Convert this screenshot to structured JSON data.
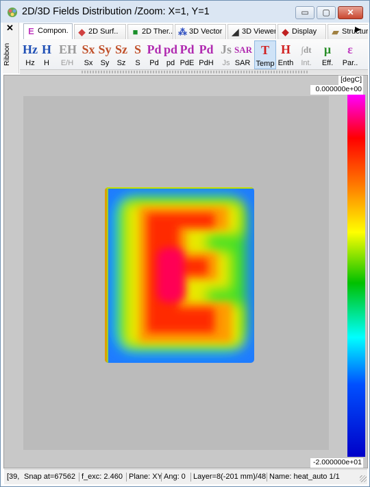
{
  "window": {
    "title": "2D/3D Fields Distribution /Zoom: X=1, Y=1",
    "controls": {
      "minimize": "▭",
      "maximize": "▢",
      "close": "✕"
    }
  },
  "ribbon": {
    "close": "✕",
    "label": "Ribbon",
    "tabs": [
      {
        "label": "Compon.",
        "icon": "E",
        "color": "#c03cc0"
      },
      {
        "label": "2D Surf..",
        "icon": "◆",
        "color": "#d04040"
      },
      {
        "label": "2D Ther..",
        "icon": "■",
        "color": "#1a8f2a"
      },
      {
        "label": "3D Vector",
        "icon": "⁂",
        "color": "#3050c0"
      },
      {
        "label": "3D Viewer",
        "icon": "◢",
        "color": "#303030"
      },
      {
        "label": "Display",
        "icon": "◆",
        "color": "#c02020"
      },
      {
        "label": "Structure",
        "icon": "▰",
        "color": "#a08040"
      }
    ],
    "tab_scroll": "▶",
    "buttons": [
      {
        "glyph": "Hz",
        "label": "Hz",
        "color": "#1f4fb5"
      },
      {
        "glyph": "H",
        "label": "H",
        "color": "#1f4fb5"
      },
      {
        "glyph": "EH",
        "label": "E/H",
        "color": "#9a9a9a"
      },
      {
        "glyph": "Sx",
        "label": "Sx",
        "color": "#c0502a"
      },
      {
        "glyph": "Sy",
        "label": "Sy",
        "color": "#c0502a"
      },
      {
        "glyph": "Sz",
        "label": "Sz",
        "color": "#c0502a"
      },
      {
        "glyph": "S",
        "label": "S",
        "color": "#c0502a"
      },
      {
        "glyph": "Pd",
        "label": "Pd",
        "color": "#b02ab0"
      },
      {
        "glyph": "pd",
        "label": "pd",
        "color": "#b02ab0"
      },
      {
        "glyph": "Pd",
        "label": "PdE",
        "color": "#b02ab0"
      },
      {
        "glyph": "Pd",
        "label": "PdH",
        "color": "#b02ab0"
      },
      {
        "glyph": "Js",
        "label": "Js",
        "color": "#9a9a9a"
      },
      {
        "glyph": "SAR",
        "label": "SAR",
        "color": "#b02ab0"
      },
      {
        "glyph": "T",
        "label": "Temp",
        "color": "#d02020"
      },
      {
        "glyph": "H",
        "label": "Enth",
        "color": "#d02020"
      },
      {
        "glyph": "∫dt",
        "label": "Int.",
        "color": "#9a9a9a"
      },
      {
        "glyph": "μ",
        "label": "Eff.",
        "color": "#2a8f2a"
      },
      {
        "glyph": "ε",
        "label": "Par..",
        "color": "#c03cc0"
      }
    ]
  },
  "colorscale": {
    "unit": "[degC]",
    "max": "0.000000e+00",
    "min": "-2.000000e+01"
  },
  "status": {
    "coords": "[39,",
    "snap": "Snap at=67562",
    "f_exc": "f_exc:  2.460",
    "plane": "Plane: XY",
    "ang": "Ang:   0",
    "layer": "Layer=8(-201 mm)/48",
    "name": "Name: heat_auto 1/1"
  }
}
